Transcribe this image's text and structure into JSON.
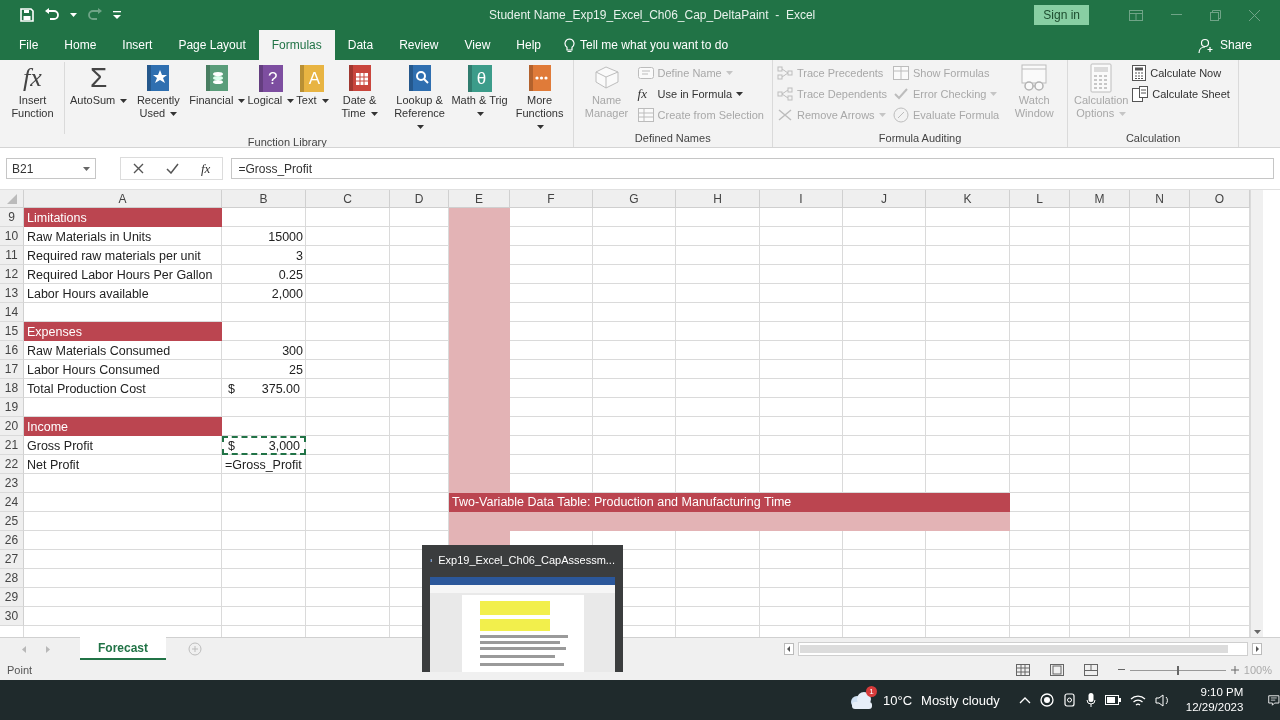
{
  "title_bar": {
    "title": "Student Name_Exp19_Excel_Ch06_Cap_DeltaPaint  -  Excel",
    "sign_in": "Sign in",
    "redo": {
      "disabled": true
    }
  },
  "ribbon_tabs": [
    {
      "label": "File",
      "selected": false
    },
    {
      "label": "Home",
      "selected": false
    },
    {
      "label": "Insert",
      "selected": false
    },
    {
      "label": "Page Layout",
      "selected": false
    },
    {
      "label": "Formulas",
      "selected": true
    },
    {
      "label": "Data",
      "selected": false
    },
    {
      "label": "Review",
      "selected": false
    },
    {
      "label": "View",
      "selected": false
    },
    {
      "label": "Help",
      "selected": false
    }
  ],
  "tell_me": "Tell me what you want to do",
  "share": "Share",
  "ribbon_groups": [
    {
      "label": "Function Library",
      "items": [
        {
          "kind": "large",
          "label": "Insert Function",
          "glyph": "fx",
          "dropdown": false,
          "disabled": false
        },
        {
          "kind": "large",
          "label": "AutoSum",
          "glyph": "Σ",
          "dropdown": true,
          "disabled": false
        },
        {
          "kind": "large",
          "label": "Recently Used",
          "dropdown": true,
          "disabled": false
        },
        {
          "kind": "large",
          "label": "Financial",
          "dropdown": true,
          "disabled": false
        },
        {
          "kind": "large",
          "label": "Logical",
          "glyph": "?",
          "dropdown": true,
          "disabled": false
        },
        {
          "kind": "large",
          "label": "Text",
          "glyph": "A",
          "dropdown": true,
          "disabled": false
        },
        {
          "kind": "large",
          "label": "Date & Time",
          "dropdown": true,
          "disabled": false
        },
        {
          "kind": "large",
          "label": "Lookup & Reference",
          "dropdown": true,
          "disabled": false
        },
        {
          "kind": "large",
          "label": "Math & Trig",
          "glyph": "θ",
          "dropdown": true,
          "disabled": false
        },
        {
          "kind": "large",
          "label": "More Functions",
          "dropdown": true,
          "disabled": false
        }
      ]
    },
    {
      "label": "Defined Names",
      "items": [
        {
          "kind": "large",
          "label": "Name Manager",
          "dropdown": false,
          "disabled": true
        },
        {
          "kind": "small",
          "label": "Define Name",
          "dropdown": true,
          "disabled": true
        },
        {
          "kind": "small",
          "label": "Use in Formula",
          "glyph": "fx",
          "dropdown": true,
          "disabled": false
        },
        {
          "kind": "small",
          "label": "Create from Selection",
          "dropdown": false,
          "disabled": true
        }
      ]
    },
    {
      "label": "Formula Auditing",
      "items": [
        {
          "kind": "small",
          "label": "Trace Precedents",
          "dropdown": false,
          "disabled": true
        },
        {
          "kind": "small",
          "label": "Trace Dependents",
          "dropdown": false,
          "disabled": true
        },
        {
          "kind": "small",
          "label": "Remove Arrows",
          "dropdown": true,
          "disabled": true
        },
        {
          "kind": "small",
          "label": "Show Formulas",
          "dropdown": false,
          "disabled": true
        },
        {
          "kind": "small",
          "label": "Error Checking",
          "dropdown": true,
          "disabled": true
        },
        {
          "kind": "small",
          "label": "Evaluate Formula",
          "dropdown": false,
          "disabled": true
        },
        {
          "kind": "large",
          "label": "Watch Window",
          "dropdown": false,
          "disabled": true
        }
      ]
    },
    {
      "label": "Calculation",
      "items": [
        {
          "kind": "large",
          "label": "Calculation Options",
          "dropdown": true,
          "disabled": true
        },
        {
          "kind": "small",
          "label": "Calculate Now",
          "dropdown": false,
          "disabled": false
        },
        {
          "kind": "small",
          "label": "Calculate Sheet",
          "dropdown": false,
          "disabled": false
        }
      ]
    }
  ],
  "formula_bar": {
    "name_box": "B21",
    "fx": "fx",
    "formula": "=Gross_Profit"
  },
  "sheet": {
    "columns": [
      "A",
      "B",
      "C",
      "D",
      "E",
      "F",
      "G",
      "H",
      "I",
      "J",
      "K",
      "L",
      "M",
      "N",
      "O"
    ],
    "rows": [
      {
        "number": "9",
        "cells": {
          "A": {
            "kind": "label",
            "text": "Limitations",
            "color": "#bb4550"
          },
          "E": {
            "color": "#e3b3b5"
          }
        }
      },
      {
        "number": "10",
        "cells": {
          "A": {
            "kind": "label",
            "text": "Raw Materials in Units"
          },
          "B": {
            "kind": "number",
            "text": "15000"
          },
          "E": {
            "color": "#e3b3b5"
          }
        }
      },
      {
        "number": "11",
        "cells": {
          "A": {
            "kind": "label",
            "text": "Required raw materials per unit"
          },
          "B": {
            "kind": "number",
            "text": "3"
          },
          "E": {
            "color": "#e3b3b5"
          }
        }
      },
      {
        "number": "12",
        "cells": {
          "A": {
            "kind": "label",
            "text": "Required Labor Hours Per Gallon"
          },
          "B": {
            "kind": "number",
            "text": "0.25"
          },
          "E": {
            "color": "#e3b3b5"
          }
        }
      },
      {
        "number": "13",
        "cells": {
          "A": {
            "kind": "label",
            "text": "Labor Hours available"
          },
          "B": {
            "kind": "number",
            "text": "2,000"
          },
          "E": {
            "color": "#e3b3b5"
          }
        }
      },
      {
        "number": "14",
        "cells": {
          "E": {
            "color": "#e3b3b5"
          }
        }
      },
      {
        "number": "15",
        "cells": {
          "A": {
            "kind": "label",
            "text": "Expenses",
            "color": "#bb4550"
          },
          "E": {
            "color": "#e3b3b5"
          }
        }
      },
      {
        "number": "16",
        "cells": {
          "A": {
            "kind": "label",
            "text": "Raw Materials Consumed"
          },
          "B": {
            "kind": "number",
            "text": "300"
          },
          "E": {
            "color": "#e3b3b5"
          }
        }
      },
      {
        "number": "17",
        "cells": {
          "A": {
            "kind": "label",
            "text": "Labor Hours Consumed"
          },
          "B": {
            "kind": "number",
            "text": "25"
          },
          "E": {
            "color": "#e3b3b5"
          }
        }
      },
      {
        "number": "18",
        "cells": {
          "A": {
            "kind": "label",
            "text": "Total Production Cost"
          },
          "B": {
            "kind": "currency",
            "symbol": "$",
            "text": "375.00"
          },
          "E": {
            "color": "#e3b3b5"
          }
        }
      },
      {
        "number": "19",
        "cells": {
          "E": {
            "color": "#e3b3b5"
          }
        }
      },
      {
        "number": "20",
        "cells": {
          "A": {
            "kind": "label",
            "text": "Income",
            "color": "#bb4550"
          },
          "E": {
            "color": "#e3b3b5"
          }
        }
      },
      {
        "number": "21",
        "cells": {
          "A": {
            "kind": "label",
            "text": "Gross Profit"
          },
          "B": {
            "kind": "currency",
            "symbol": "$",
            "text": "3,000",
            "marquee": true
          },
          "E": {
            "color": "#e3b3b5"
          }
        }
      },
      {
        "number": "22",
        "cells": {
          "A": {
            "kind": "label",
            "text": "Net Profit"
          },
          "B": {
            "kind": "label",
            "text": "=Gross_Profit"
          },
          "E": {
            "color": "#e3b3b5"
          }
        }
      },
      {
        "number": "23",
        "cells": {
          "E": {
            "color": "#e3b3b5"
          }
        }
      },
      {
        "number": "24",
        "cells": {
          "E": {
            "kind": "label",
            "text": "Two-Variable Data Table: Production and Manufacturing Time",
            "color": "#bb4550"
          },
          "F": {
            "color": "#bb4550"
          },
          "G": {
            "color": "#bb4550"
          },
          "H": {
            "color": "#bb4550"
          },
          "I": {
            "color": "#bb4550"
          },
          "J": {
            "color": "#bb4550"
          },
          "K": {
            "color": "#bb4550"
          }
        }
      },
      {
        "number": "25",
        "cells": {
          "E": {
            "color": "#e3b3b5"
          },
          "F": {
            "color": "#e3b3b5"
          },
          "G": {
            "color": "#e3b3b5"
          },
          "H": {
            "color": "#e3b3b5"
          },
          "I": {
            "color": "#e3b3b5"
          },
          "J": {
            "color": "#e3b3b5"
          },
          "K": {
            "color": "#e3b3b5"
          }
        }
      },
      {
        "number": "26",
        "cells": {
          "E": {
            "color": "#e3b3b5"
          }
        }
      },
      {
        "number": "27",
        "cells": {}
      },
      {
        "number": "28",
        "cells": {}
      },
      {
        "number": "29",
        "cells": {}
      },
      {
        "number": "30",
        "cells": {}
      }
    ]
  },
  "sheet_tabs": [
    {
      "label": "Forecast",
      "selected": true
    }
  ],
  "status_bar": {
    "mode": "Point",
    "zoom": {
      "level": 0.5,
      "reading": "100%"
    }
  },
  "taskbar_preview": {
    "title": "Exp19_Excel_Ch06_CapAssessm...",
    "kind": "picture"
  },
  "taskbar": {
    "weather_badge": "1",
    "temperature": "10°C",
    "weather": "Mostly cloudy",
    "time": "9:10 PM",
    "date": "12/29/2023"
  }
}
